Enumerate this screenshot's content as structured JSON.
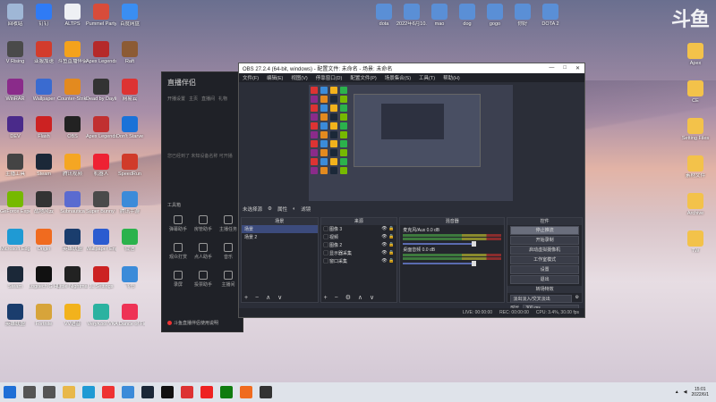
{
  "desktop": {
    "logo_text": "斗鱼",
    "icons_left": [
      {
        "label": "回收站",
        "color": "#9fb7d6"
      },
      {
        "label": "钉钉",
        "color": "#2f7bf5"
      },
      {
        "label": "ALTPS",
        "color": "#eef0f4"
      },
      {
        "label": "Pummel Party",
        "color": "#d84c3a"
      },
      {
        "label": "百度网盘",
        "color": "#3a8ef2"
      },
      {
        "label": "V Rising",
        "color": "#4a4a4a"
      },
      {
        "label": "亚服加速",
        "color": "#d23c2c"
      },
      {
        "label": "斗鱼直播伴侣",
        "color": "#f4a21c"
      },
      {
        "label": "Apex Legends",
        "color": "#b52a2a"
      },
      {
        "label": "Raft",
        "color": "#8c5b34"
      },
      {
        "label": "WinRAR",
        "color": "#8a2b8a"
      },
      {
        "label": "Wallpaper",
        "color": "#3a6bd0"
      },
      {
        "label": "Counter-Strike",
        "color": "#e38a1f"
      },
      {
        "label": "Dead by Daylight",
        "color": "#333"
      },
      {
        "label": "网易云",
        "color": "#d33"
      },
      {
        "label": "DEV",
        "color": "#4a2a8a"
      },
      {
        "label": "Flash",
        "color": "#c22"
      },
      {
        "label": "OBS",
        "color": "#222"
      },
      {
        "label": "Apex Legends",
        "color": "#c13030"
      },
      {
        "label": "Don't Starve",
        "color": "#1a72d8"
      },
      {
        "label": "主播工具",
        "color": "#444"
      },
      {
        "label": "Steam",
        "color": "#1b2838"
      },
      {
        "label": "腾讯视频",
        "color": "#f5a623"
      },
      {
        "label": "机器人",
        "color": "#e23"
      },
      {
        "label": "SpeedRun",
        "color": "#d03b2a"
      },
      {
        "label": "GeForce Experience",
        "color": "#76b900"
      },
      {
        "label": "战地风云",
        "color": "#333"
      },
      {
        "label": "Subnautica",
        "color": "#5a6bd0"
      },
      {
        "label": "Super Bunny Man",
        "color": "#4a4a4a"
      },
      {
        "label": "腾讯手游",
        "color": "#3b8bd9"
      },
      {
        "label": "Microsoft Edge",
        "color": "#1f9ad4"
      },
      {
        "label": "Origin",
        "color": "#f06b1f"
      },
      {
        "label": "英雄联盟",
        "color": "#1a3d6d"
      },
      {
        "label": "Wallpaper Engine",
        "color": "#2a5bd0"
      },
      {
        "label": "微信",
        "color": "#2bb24c"
      },
      {
        "label": "Steam",
        "color": "#1b2838"
      },
      {
        "label": "Logitech G HUB",
        "color": "#111"
      },
      {
        "label": "Little Nightmares",
        "color": "#222"
      },
      {
        "label": "JL Settings",
        "color": "#c22"
      },
      {
        "label": "飞书",
        "color": "#3b8bd9"
      },
      {
        "label": "英雄联盟",
        "color": "#1a3d6d"
      },
      {
        "label": "Fortnite",
        "color": "#d7a43a"
      },
      {
        "label": "VV语音",
        "color": "#f2b21c"
      },
      {
        "label": "VeryKool VK",
        "color": "#2bb2a0"
      },
      {
        "label": "A Dance of Fire",
        "color": "#e35"
      }
    ],
    "icons_top": [
      {
        "label": "dota",
        "color": "#5a8fd6"
      },
      {
        "label": "2022年6月10...",
        "color": "#5a8fd6"
      },
      {
        "label": "mao",
        "color": "#5a8fd6"
      },
      {
        "label": "dog",
        "color": "#5a8fd6"
      },
      {
        "label": "gogo",
        "color": "#5a8fd6"
      },
      {
        "label": "你好",
        "color": "#5a8fd6"
      },
      {
        "label": "DOTA 2",
        "color": "#5a8fd6"
      }
    ],
    "icons_right": [
      {
        "label": "Apex",
        "color": "#f3c24a"
      },
      {
        "label": "CE",
        "color": "#f3c24a"
      },
      {
        "label": "Setting Files",
        "color": "#f3c24a"
      },
      {
        "label": "素材文件",
        "color": "#f3c24a"
      },
      {
        "label": "Archive",
        "color": "#f3c24a"
      },
      {
        "label": "TW",
        "color": "#f3c24a"
      }
    ]
  },
  "zhibo": {
    "title": "直播伴侣",
    "tabs": [
      "开播设置",
      "主页",
      "直播间",
      "礼物"
    ],
    "hint": "您已经到了 未知设备名称 可开播",
    "tools_label": "工具箱",
    "tools": [
      "弹幕助手",
      "房管助手",
      "主播任务",
      "观众打赏",
      "点人助手",
      "音乐",
      "录屏",
      "投票助手",
      "主播间"
    ],
    "footer": "斗鱼直播伴侣使用说明"
  },
  "obs": {
    "title": "OBS 27.2.4 (64-bit, windows) - 配置文件: 未命名 - 场景: 未命名",
    "menu": [
      "文件(F)",
      "编辑(E)",
      "视图(V)",
      "停靠窗口(D)",
      "配置文件(P)",
      "场景集合(S)",
      "工具(T)",
      "帮助(H)"
    ],
    "no_source": "未选择源",
    "props": "属性",
    "filters": "滤镜",
    "docks": {
      "scenes": {
        "header": "场景",
        "items": [
          "场景",
          "场景 2"
        ]
      },
      "sources": {
        "header": "来源",
        "items": [
          "图像 3",
          "视频",
          "图像 2",
          "显示器采集",
          "窗口采集"
        ]
      },
      "mixer": {
        "header": "混音器",
        "tracks": [
          {
            "name": "麦克风/Aux",
            "value": "0.0 dB"
          },
          {
            "name": "桌面音频",
            "value": "0.0 dB"
          }
        ]
      },
      "controls": {
        "header": "控件",
        "buttons": [
          "停止推流",
          "开始录制",
          "启动虚拟摄像机",
          "工作室模式",
          "设置",
          "退出"
        ]
      },
      "transitions": {
        "header": "转场特效",
        "type": "淡出淡入/交叉淡出",
        "duration_label": "时长",
        "duration": "300 ms"
      }
    },
    "status": {
      "live": "LIVE: 00:00:00",
      "rec": "REC: 00:00:00",
      "cpu": "CPU: 3.4%, 30.00 fps"
    }
  },
  "taskbar": {
    "time": "15:01",
    "date": "2022/6/1",
    "apps": [
      {
        "name": "windows-icon",
        "color": "#1f6fd6"
      },
      {
        "name": "search-icon",
        "color": "#555"
      },
      {
        "name": "task-view-icon",
        "color": "#555"
      },
      {
        "name": "file-explorer-icon",
        "color": "#e8b84a"
      },
      {
        "name": "edge-icon",
        "color": "#1f9ad4"
      },
      {
        "name": "chrome-icon",
        "color": "#e33"
      },
      {
        "name": "store-icon",
        "color": "#3b8bd9"
      },
      {
        "name": "steam-icon",
        "color": "#1b2838"
      },
      {
        "name": "tiktok-icon",
        "color": "#111"
      },
      {
        "name": "netease-icon",
        "color": "#d33"
      },
      {
        "name": "red-app-icon",
        "color": "#e22"
      },
      {
        "name": "xbox-icon",
        "color": "#107c10"
      },
      {
        "name": "douyu-icon",
        "color": "#f06b1f"
      },
      {
        "name": "obs-icon",
        "color": "#333"
      }
    ]
  }
}
